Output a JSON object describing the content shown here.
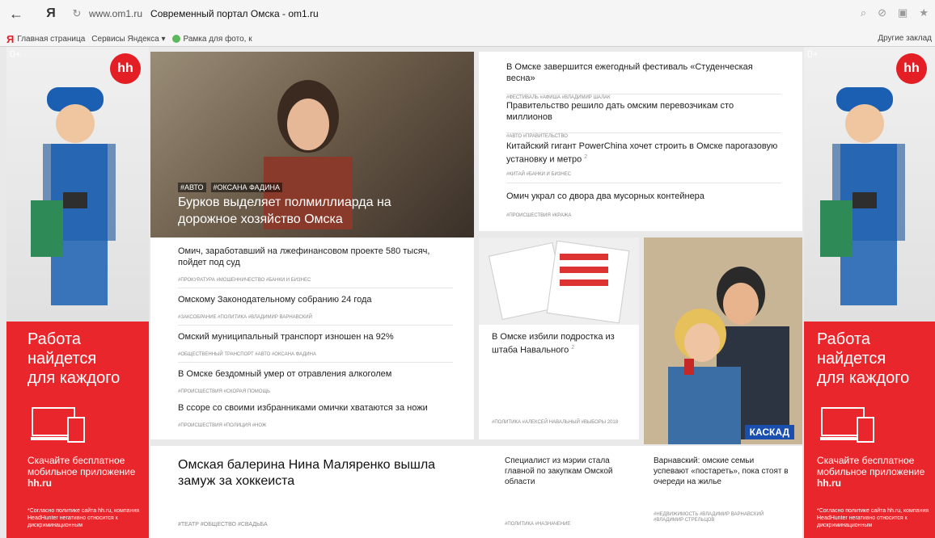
{
  "browser": {
    "back": "←",
    "yandex_logo": "Я",
    "reload": "↻",
    "url": "www.om1.ru",
    "page_title": "Современный портал Омска - om1.ru",
    "icons": [
      "search-icon",
      "block-icon",
      "reader-icon",
      "star-icon"
    ]
  },
  "bookmarks": {
    "items": [
      "Главная страница",
      "Сервисы Яндекса ▾",
      "Рамка для фото, к"
    ],
    "other": "Другие заклад"
  },
  "ad": {
    "age": "0+",
    "hh": "hh",
    "headline": [
      "Работа",
      "найдется",
      "для каждого"
    ],
    "app_text": [
      "Скачайте бесплатное",
      "мобильное приложение"
    ],
    "app_domain": "hh.ru",
    "fine": "*Согласно политике сайта hh.ru, компания HeadHunter негативно относится к дискриминационным"
  },
  "hero": {
    "tags": [
      "#АВТО",
      "#ОКСАНА ФАДИНА"
    ],
    "title": "Бурков выделяет полмиллиарда на дорожное хозяйство Омска"
  },
  "news_list": [
    {
      "title": "В Омске завершится ежегодный фестиваль «Студенческая весна»",
      "tags": "#ФЕСТИВАЛЬ  #АФИША  #ВЛАДИМИР ШАЛАК"
    },
    {
      "title": "Правительство решило дать омским перевозчикам сто миллионов",
      "tags": "#АВТО  #ПРАВИТЕЛЬСТВО"
    },
    {
      "title": "Китайский гигант PowerChina хочет строить в Омске парогазовую установку и метро",
      "tags": "#КИТАЙ  #БАНКИ И БИЗНЕС"
    },
    {
      "title": "Омич украл со двора два мусорных контейнера",
      "tags": "#ПРОИСШЕСТВИЯ  #КРАЖА"
    }
  ],
  "mid_list": [
    {
      "title": "Омич, заработавший на лжефинансовом проекте 580 тысяч, пойдет под суд",
      "tags": "#ПРОКУРАТУРА  #МОШЕННИЧЕСТВО  #БАНКИ И БИЗНЕС"
    },
    {
      "title": "Омскому Законодательному собранию 24 года",
      "tags": "#ЗАКСОБРАНИЕ  #ПОЛИТИКА  #ВЛАДИМИР ВАРНАВСКИЙ"
    },
    {
      "title": "Омский муниципальный транспорт изношен на 92%",
      "tags": "#ОБЩЕСТВЕННЫЙ ТРАНСПОРТ  #АВТО  #ОКСАНА ФАДИНА"
    },
    {
      "title": "В Омске бездомный умер от отравления алкоголем",
      "tags": "#ПРОИСШЕСТВИЯ  #СКОРАЯ ПОМОЩЬ"
    },
    {
      "title": "В ссоре со своими избранниками омички хватаются за ножи",
      "tags": "#ПРОИСШЕСТВИЯ  #ПОЛИЦИЯ  #НОЖ"
    }
  ],
  "photo_card": {
    "title": "В Омске избили подростка из штаба Навального",
    "sup": "2",
    "tags": "#ПОЛИТИКА  #АЛЕКСЕЙ НАВАЛЬНЫЙ  #ВЫБОРЫ 2018"
  },
  "poster": {
    "logo": "КАСКАД"
  },
  "bottom": {
    "big_title": "Омская балерина Нина Маляренко вышла замуж за хоккеиста",
    "big_tags": "#ТЕАТР  #ОБЩЕСТВО  #СВАДЬБА",
    "c2_title": "Специалист из мэрии стала главной по закупкам Омской области",
    "c2_tags": "#ПОЛИТИКА  #НАЗНАЧЕНИЕ",
    "c3_title": "Варнавский: омские семьи успевают «постареть», пока стоят в очереди на жилье",
    "c3_tags": "#НЕДВИЖИМОСТЬ  #ВЛАДИМИР ВАРНАВСКИЙ  #ВЛАДИМИР СТРЕЛЬЦОВ"
  },
  "colors": {
    "hh_red": "#e8262b",
    "accent_blue": "#1a4fb0"
  }
}
